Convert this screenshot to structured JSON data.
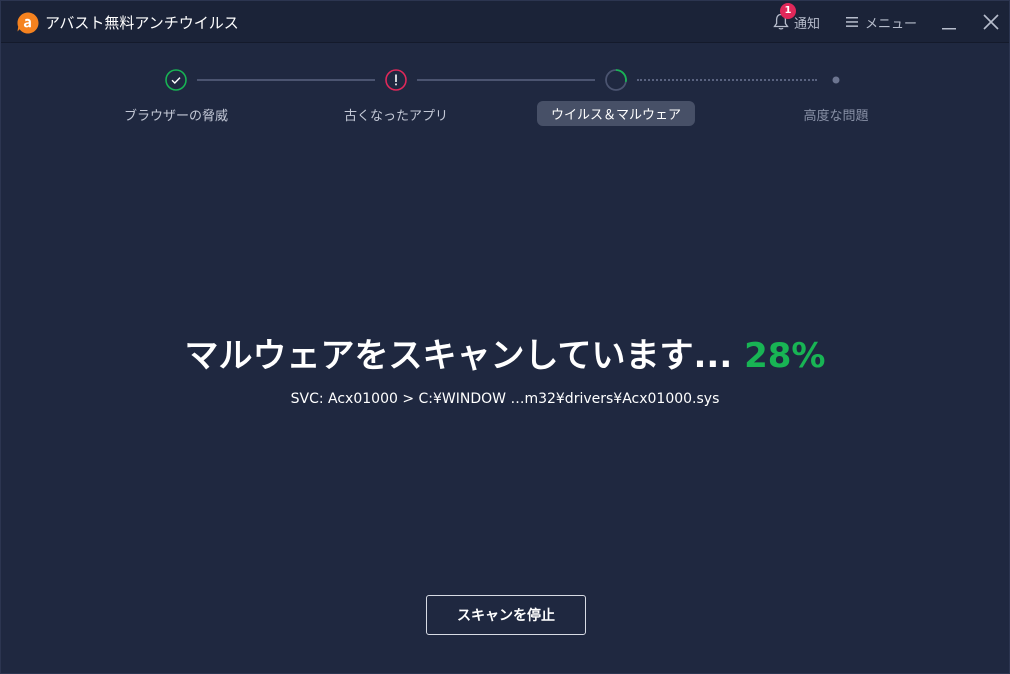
{
  "window": {
    "title": "アバスト無料アンチウイルス"
  },
  "header": {
    "notifications": {
      "label": "通知",
      "count": "1"
    },
    "menu": {
      "label": "メニュー"
    }
  },
  "steps": [
    {
      "label": "ブラウザーの脅威",
      "status": "done"
    },
    {
      "label": "古くなったアプリ",
      "status": "warning"
    },
    {
      "label": "ウイルス＆マルウェア",
      "status": "active"
    },
    {
      "label": "高度な問題",
      "status": "pending"
    }
  ],
  "scan": {
    "headline": "マルウェアをスキャンしています...",
    "percent_text": "28%",
    "progress_fraction": 0.28,
    "current_file": "SVC: Acx01000 > C:¥WINDOW …m32¥drivers¥Acx01000.sys"
  },
  "actions": {
    "stop_label": "スキャンを停止"
  },
  "colors": {
    "background": "#1f2840",
    "titlebar": "#1b2338",
    "accent_green": "#18b454",
    "warning_pink": "#e0285a",
    "logo_orange": "#f5821f"
  }
}
